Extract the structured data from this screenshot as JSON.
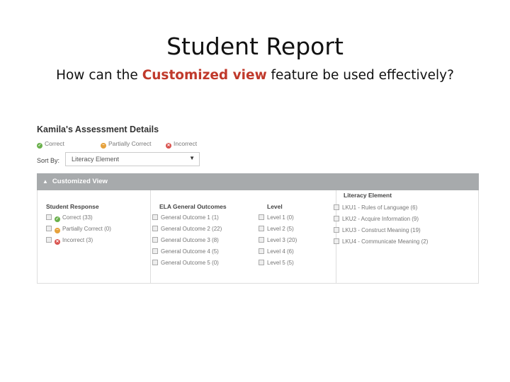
{
  "slide": {
    "title": "Student Report",
    "subtitle_pre": "How can the ",
    "subtitle_highlight": "Customized view",
    "subtitle_post": " feature be used effectively?"
  },
  "report": {
    "title": "Kamila's Assessment Details",
    "legend": [
      {
        "label": "Correct",
        "icon": "check-circle-icon",
        "color": "#6ab04c"
      },
      {
        "label": "Partially Correct",
        "icon": "partial-circle-icon",
        "color": "#e6a23c"
      },
      {
        "label": "Incorrect",
        "icon": "x-circle-icon",
        "color": "#d9534f"
      }
    ],
    "sort_label": "Sort By:",
    "sort_value": "Literacy Element",
    "customized_view_label": "Customized View",
    "columns": {
      "student_response": {
        "header": "Student Response",
        "items": [
          "Correct (33)",
          "Partially Correct (0)",
          "Incorrect (3)"
        ]
      },
      "ela": {
        "header": "ELA General Outcomes",
        "items": [
          "General Outcome 1 (1)",
          "General Outcome 2 (22)",
          "General Outcome 3 (8)",
          "General Outcome 4 (5)",
          "General Outcome 5 (0)"
        ]
      },
      "level": {
        "header": "Level",
        "items": [
          "Level 1 (0)",
          "Level 2 (5)",
          "Level 3 (20)",
          "Level 4 (6)",
          "Level 5 (5)"
        ]
      },
      "literacy": {
        "header": "Literacy Element",
        "items": [
          "LKU1 - Rules of Language (6)",
          "LKU2 - Acquire Information (9)",
          "LKU3 - Construct Meaning (19)",
          "LKU4 - Communicate Meaning (2)"
        ]
      }
    }
  }
}
